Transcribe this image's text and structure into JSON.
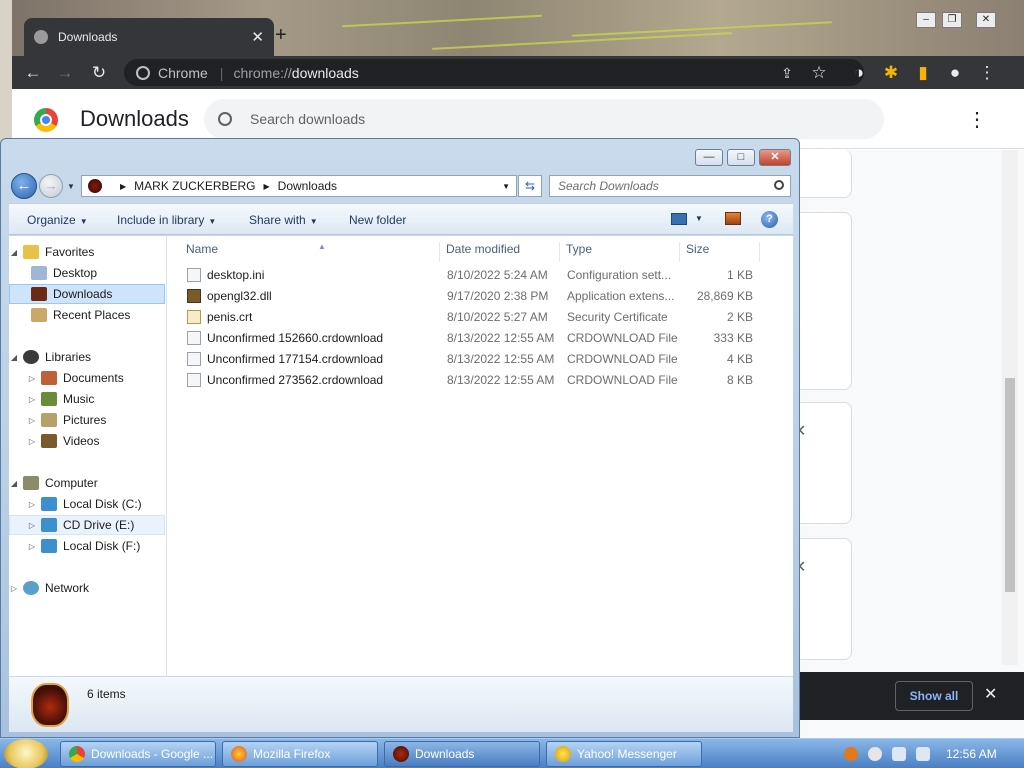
{
  "chrome": {
    "tab_title": "Downloads",
    "tab_close": "✕",
    "new_tab": "+",
    "window_buttons": {
      "minimize": "–",
      "restore": "❐",
      "close": "✕"
    },
    "omnibox": {
      "site": "Chrome",
      "scheme": "chrome://",
      "path": "downloads"
    },
    "page_title": "Downloads",
    "search_placeholder": "Search downloads",
    "card_close": "✕",
    "show_all": "Show all",
    "bar_close": "✕"
  },
  "explorer": {
    "window_buttons": {
      "minimize": "—",
      "maximize": "□",
      "close": "✕"
    },
    "address": {
      "root": "MARK ZUCKERBERG",
      "folder": "Downloads"
    },
    "search_placeholder": "Search Downloads",
    "commands": {
      "organize": "Organize",
      "include": "Include in library",
      "share": "Share with",
      "new_folder": "New folder",
      "help": "?"
    },
    "nav": {
      "favorites": "Favorites",
      "desktop": "Desktop",
      "downloads": "Downloads",
      "recent": "Recent Places",
      "libraries": "Libraries",
      "documents": "Documents",
      "music": "Music",
      "pictures": "Pictures",
      "videos": "Videos",
      "computer": "Computer",
      "local_c": "Local Disk (C:)",
      "cd_e": "CD Drive (E:)",
      "local_f": "Local Disk (F:)",
      "network": "Network"
    },
    "columns": {
      "name": "Name",
      "date": "Date modified",
      "type": "Type",
      "size": "Size"
    },
    "files": [
      {
        "name": "desktop.ini",
        "date": "8/10/2022 5:24 AM",
        "type": "Configuration sett...",
        "size": "1 KB"
      },
      {
        "name": "opengl32.dll",
        "date": "9/17/2020 2:38 PM",
        "type": "Application extens...",
        "size": "28,869 KB"
      },
      {
        "name": "penis.crt",
        "date": "8/10/2022 5:27 AM",
        "type": "Security Certificate",
        "size": "2 KB"
      },
      {
        "name": "Unconfirmed 152660.crdownload",
        "date": "8/13/2022 12:55 AM",
        "type": "CRDOWNLOAD File",
        "size": "333 KB"
      },
      {
        "name": "Unconfirmed 177154.crdownload",
        "date": "8/13/2022 12:55 AM",
        "type": "CRDOWNLOAD File",
        "size": "4 KB"
      },
      {
        "name": "Unconfirmed 273562.crdownload",
        "date": "8/13/2022 12:55 AM",
        "type": "CRDOWNLOAD File",
        "size": "8 KB"
      }
    ],
    "item_count": "6 items"
  },
  "taskbar": {
    "tasks": [
      {
        "label": "Downloads - Google ..."
      },
      {
        "label": "Mozilla Firefox"
      },
      {
        "label": "Downloads"
      },
      {
        "label": "Yahoo! Messenger"
      }
    ],
    "clock": "12:56 AM"
  },
  "colors": {
    "chrome_toolbar": "#35363a",
    "chrome_blue": "#8ab4f8",
    "explorer_frame": "#b9cfe6",
    "selection": "#cde4fb",
    "taskbar": "#4a7fc4"
  }
}
